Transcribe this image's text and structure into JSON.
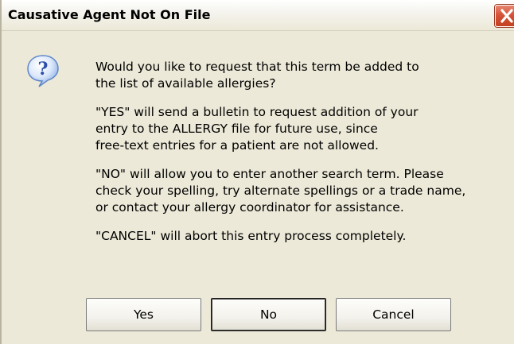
{
  "window": {
    "title": "Causative Agent Not On File"
  },
  "icons": {
    "dialog_icon": "question-icon",
    "close_icon": "close-icon"
  },
  "colors": {
    "dialog_background": "#ece9d8",
    "close_button": "#d6533a",
    "question_icon_blue": "#2b63c6"
  },
  "message": {
    "paragraphs": [
      {
        "lines": [
          "Would you like to request that this term be added to",
          "the list of available allergies?"
        ]
      },
      {
        "lines": [
          "\"YES\" will send a bulletin to request addition of your",
          "entry to the ALLERGY file for future use, since",
          "free-text entries for a patient are not allowed."
        ]
      },
      {
        "lines": [
          "\"NO\" will allow you to enter another search term.  Please",
          "check your spelling, try alternate spellings or a trade name,",
          "or contact your allergy coordinator for assistance."
        ]
      },
      {
        "lines": [
          "\"CANCEL\" will abort this entry process completely."
        ]
      }
    ]
  },
  "buttons": {
    "yes_label": "Yes",
    "no_label": "No",
    "cancel_label": "Cancel"
  }
}
